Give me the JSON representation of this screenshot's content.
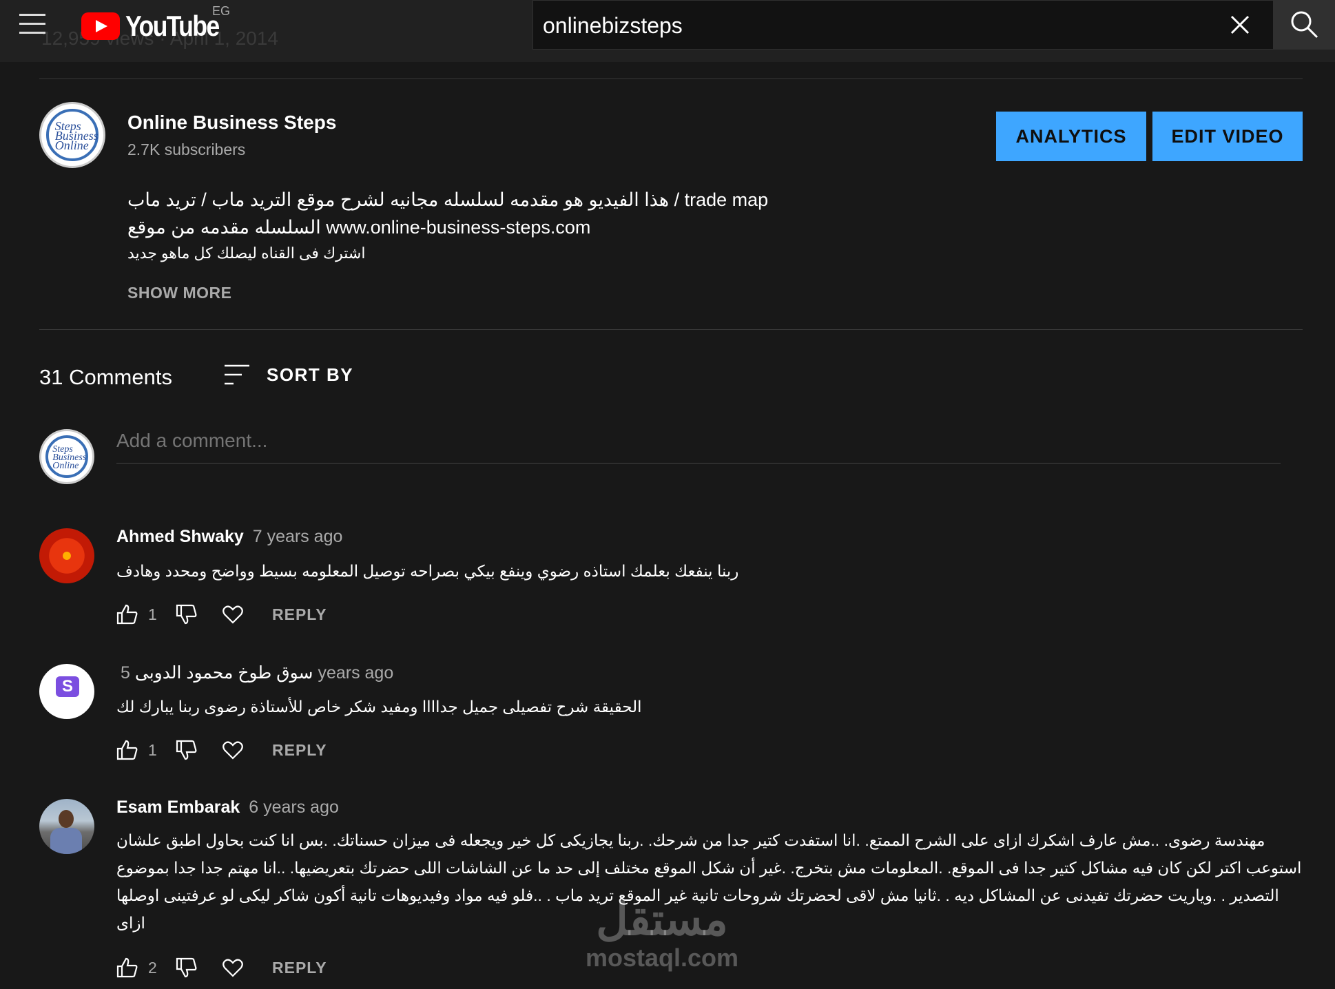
{
  "header": {
    "logo_text": "YouTube",
    "region": "EG",
    "search_value": "onlinebizsteps",
    "ghost_views": "12,959 views · April 1, 2014"
  },
  "channel": {
    "name": "Online Business Steps",
    "subscribers": "2.7K subscribers",
    "analytics_label": "ANALYTICS",
    "edit_label": "EDIT VIDEO"
  },
  "description": {
    "lines": [
      "هذا الفيديو هو مقدمه لسلسله مجانيه لشرح موقع التريد ماب / تريد ماب / trade map",
      "السلسله مقدمه من موقع www.online-business-steps.com",
      "اشترك فى القناه ليصلك كل ماهو جديد"
    ],
    "show_more": "SHOW MORE"
  },
  "comments_section": {
    "count_label": "31 Comments",
    "sort_label": "SORT BY",
    "add_placeholder": "Add a comment...",
    "reply_label": "REPLY"
  },
  "comments": [
    {
      "author": "Ahmed Shwaky",
      "time": "7 years ago",
      "text": "ربنا ينفعك بعلمك استاذه رضوي وينفع بيكي بصراحه  توصيل المعلومه بسيط وواضح ومحدد وهادف",
      "likes": "1"
    },
    {
      "author": "سوق طوخ محمود الدوبى",
      "time": "5 years ago",
      "text": "الحقيقة شرح تفصيلى جميل جداااا ومفيد شكر خاص للأستاذة رضوى ربنا يبارك لك",
      "likes": "1"
    },
    {
      "author": "Esam Embarak",
      "time": "6 years ago",
      "text_lines": [
        "مهندسة رضوى. ..مش عارف اشكرك ازاى على الشرح الممتع. .انا استفدت كتير جدا من شرحك. .ربنا يجازيكى كل خير ويجعله فى ميزان حسناتك. .بس انا كنت بحاول اطبق علشان",
        "استوعب اكتر لكن كان فيه مشاكل كتير جدا فى الموقع. .المعلومات مش بتخرج. .غير أن شكل الموقع مختلف إلى حد ما عن الشاشات اللى حضرتك بتعريضيها. ..انا مهتم جدا جدا بموضوع",
        "التصدير . .وياريت حضرتك تفيدنى عن المشاكل ديه . .ثانيا مش لاقى لحضرتك شروحات تانية غير الموقع تريد ماب . ..فلو فيه مواد وفيديوهات تانية أكون شاكر ليكى لو عرفتينى اوصلها",
        "ازاى"
      ],
      "likes": "2"
    }
  ],
  "watermark": {
    "ar": "مستقل",
    "en": "mostaql.com"
  }
}
